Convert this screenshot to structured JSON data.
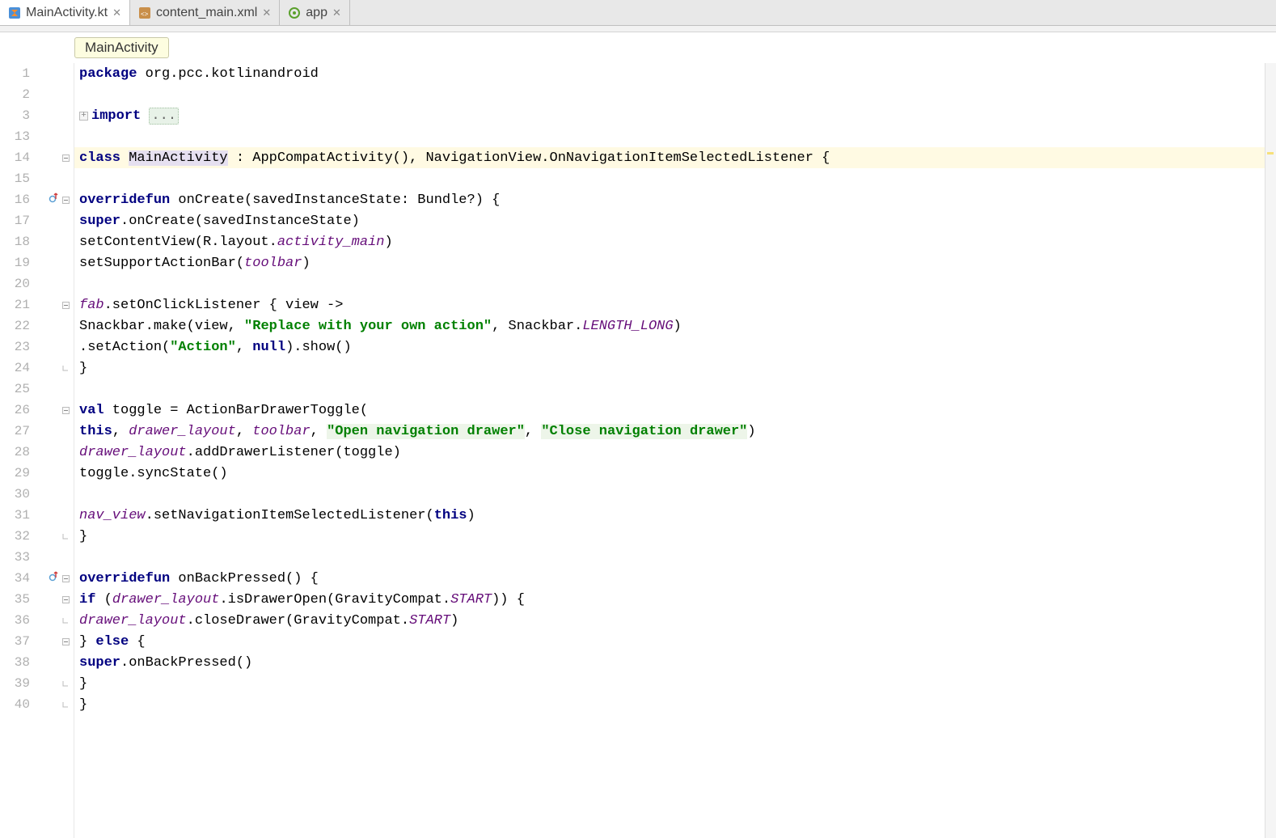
{
  "tabs": [
    {
      "label": "MainActivity.kt",
      "active": true,
      "icon": "kotlin-file-icon"
    },
    {
      "label": "content_main.xml",
      "active": false,
      "icon": "xml-file-icon"
    },
    {
      "label": "app",
      "active": false,
      "icon": "module-icon"
    }
  ],
  "breadcrumb": "MainActivity",
  "line_numbers": [
    "1",
    "2",
    "3",
    "13",
    "14",
    "15",
    "16",
    "17",
    "18",
    "19",
    "20",
    "21",
    "22",
    "23",
    "24",
    "25",
    "26",
    "27",
    "28",
    "29",
    "30",
    "31",
    "32",
    "33",
    "34",
    "35",
    "36",
    "37",
    "38",
    "39",
    "40"
  ],
  "code": {
    "l1_package": "package",
    "l1_pkg": " org.pcc.kotlinandroid",
    "l3_import": "import",
    "l3_dots": "...",
    "l14_class": "class",
    "l14_name": "MainActivity",
    "l14_rest": " : AppCompatActivity(), NavigationView.OnNavigationItemSelectedListener {",
    "l16_override": "override",
    "l16_fun": "fun",
    "l16_sig": " onCreate(savedInstanceState: Bundle?) {",
    "l17_super": "super",
    "l17_rest": ".onCreate(savedInstanceState)",
    "l18_a": "setContentView(R.layout.",
    "l18_b": "activity_main",
    "l18_c": ")",
    "l19_a": "setSupportActionBar(",
    "l19_b": "toolbar",
    "l19_c": ")",
    "l21_a": "fab",
    "l21_b": ".setOnClickListener { view ->",
    "l22_a": "Snackbar.make(view, ",
    "l22_s": "\"Replace with your own action\"",
    "l22_b": ", Snackbar.",
    "l22_c": "LENGTH_LONG",
    "l22_d": ")",
    "l23_a": ".setAction(",
    "l23_s": "\"Action\"",
    "l23_b": ", ",
    "l23_null": "null",
    "l23_c": ").show()",
    "l24": "}",
    "l26_val": "val",
    "l26_a": " toggle = ActionBarDrawerToggle(",
    "l27_this": "this",
    "l27_a": ", ",
    "l27_b": "drawer_layout",
    "l27_c": ", ",
    "l27_d": "toolbar",
    "l27_e": ", ",
    "l27_s1": "\"Open navigation drawer\"",
    "l27_f": ", ",
    "l27_s2": "\"Close navigation drawer\"",
    "l27_g": ")",
    "l28_a": "drawer_layout",
    "l28_b": ".addDrawerListener(toggle)",
    "l29": "toggle.syncState()",
    "l31_a": "nav_view",
    "l31_b": ".setNavigationItemSelectedListener(",
    "l31_this": "this",
    "l31_c": ")",
    "l32": "}",
    "l34_override": "override",
    "l34_fun": "fun",
    "l34_sig": " onBackPressed() {",
    "l35_if": "if",
    "l35_a": " (",
    "l35_b": "drawer_layout",
    "l35_c": ".isDrawerOpen(GravityCompat.",
    "l35_d": "START",
    "l35_e": ")) {",
    "l36_a": "drawer_layout",
    "l36_b": ".closeDrawer(GravityCompat.",
    "l36_c": "START",
    "l36_d": ")",
    "l37_a": "} ",
    "l37_else": "else",
    "l37_b": " {",
    "l38_super": "super",
    "l38_a": ".onBackPressed()",
    "l39": "}",
    "l40": "}"
  }
}
